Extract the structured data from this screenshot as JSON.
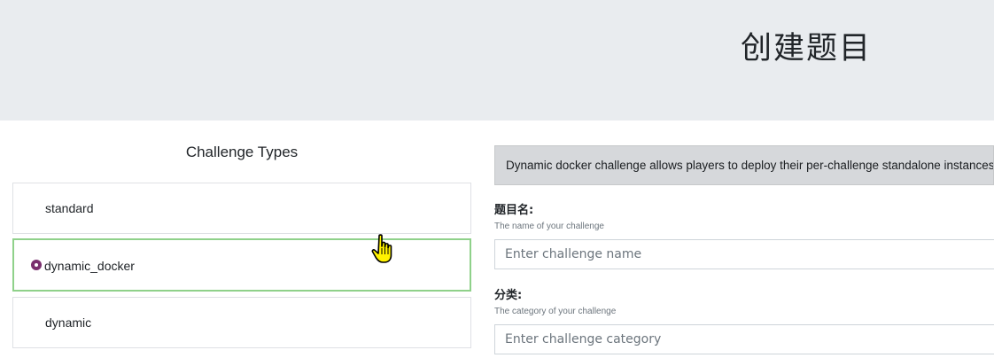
{
  "header": {
    "title": "创建题目"
  },
  "challenge_types": {
    "title": "Challenge Types",
    "items": [
      {
        "label": "standard",
        "selected": false
      },
      {
        "label": "dynamic_docker",
        "selected": true
      },
      {
        "label": "dynamic",
        "selected": false
      }
    ]
  },
  "form": {
    "description": "Dynamic docker challenge allows players to deploy their per-challenge standalone instances.",
    "name": {
      "label": "题目名:",
      "help": "The name of your challenge",
      "placeholder": "Enter challenge name"
    },
    "category": {
      "label": "分类:",
      "help": "The category of your challenge",
      "placeholder": "Enter challenge category"
    }
  },
  "colors": {
    "selected_border": "#8fd18a",
    "radio": "#7a2f6e",
    "jumbotron": "#e9ecef"
  },
  "icons": {
    "cursor": "hand-pointer-icon"
  }
}
